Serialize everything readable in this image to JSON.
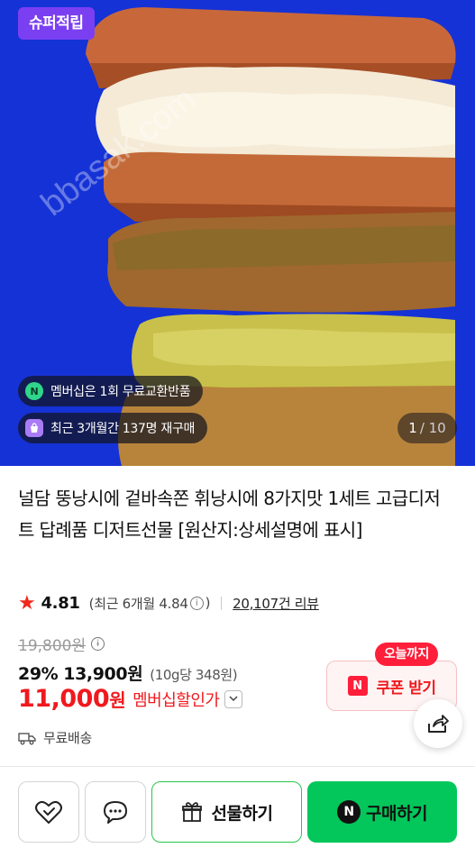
{
  "hero": {
    "badge": "슈퍼적립",
    "watermark": "bbasak.com",
    "membership_pill": "멤버십은 1회 무료교환반품",
    "membership_icon": "N",
    "repurchase_pill": "최근 3개월간 137명 재구매",
    "pager_current": "1",
    "pager_total": "/ 10"
  },
  "product": {
    "title": "널담 뚱낭시에 겉바속쫀 휘낭시에 8가지맛 1세트 고급디저트 답례품 디저트선물 [원산지:상세설명에 표시]",
    "rating": "4.81",
    "recent_rating": "(최근 6개월 4.84",
    "recent_rating_close": ")",
    "review_count": "20,107건 리뷰"
  },
  "price": {
    "original": "19,800원",
    "discount_pct": "29%",
    "sale_price": "13,900원",
    "unit_price": "(10g당 348원)",
    "member_price": "11,000",
    "member_won": "원",
    "member_label": "멤버십할인가"
  },
  "coupon": {
    "today_badge": "오늘까지",
    "label": "쿠폰 받기",
    "logo": "N"
  },
  "shipping": {
    "label": "무료배송"
  },
  "bottom_bar": {
    "gift_label": "선물하기",
    "buy_label": "구매하기",
    "buy_logo": "N"
  },
  "colors": {
    "hero_bg": "#1532d6",
    "accent_red": "#f0191e",
    "naver_green": "#03c75a",
    "super_badge": "#7b3ff2"
  }
}
